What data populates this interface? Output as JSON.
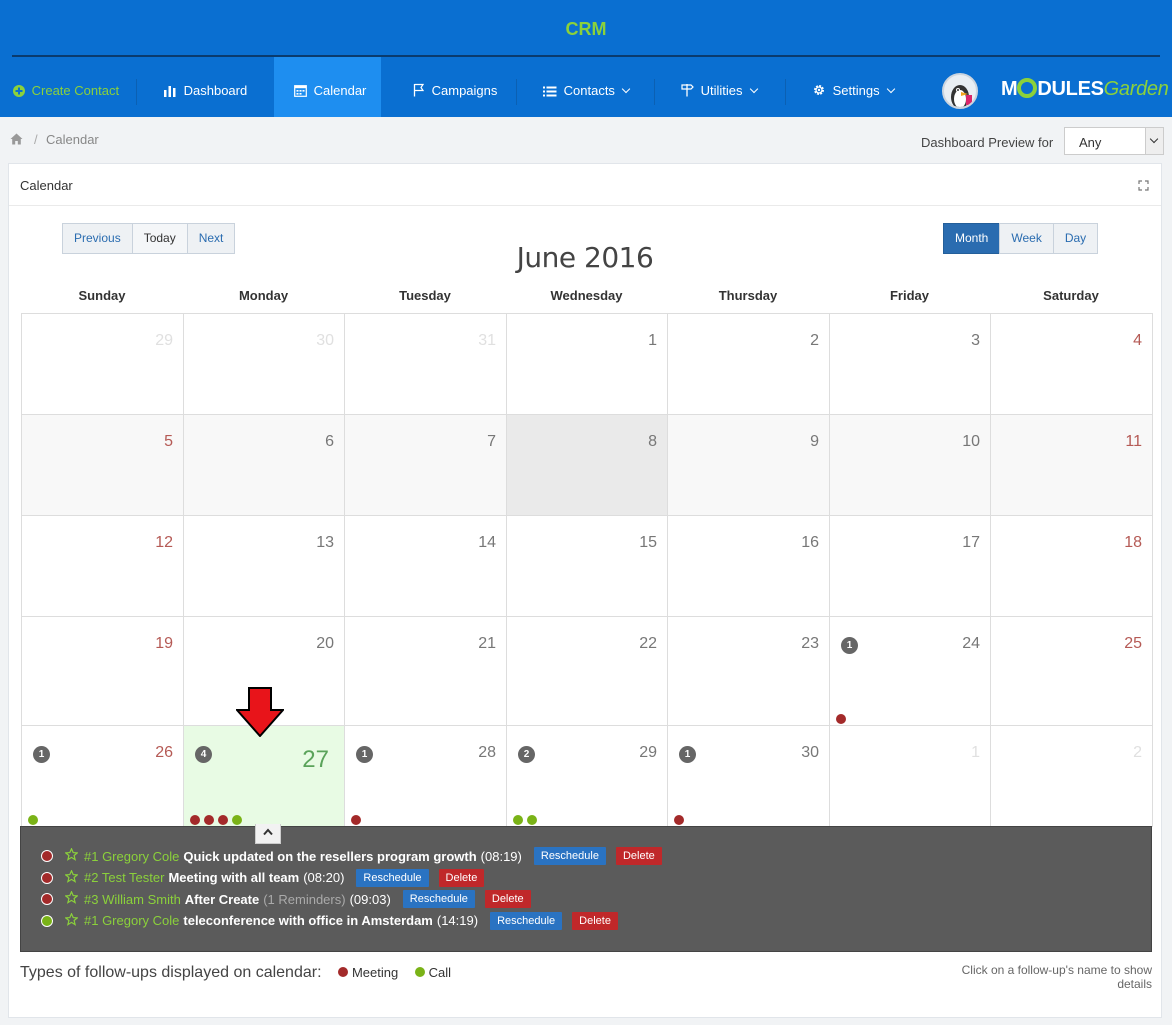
{
  "app": {
    "title": "CRM"
  },
  "nav": {
    "create_contact": "Create Contact",
    "dashboard": "Dashboard",
    "calendar": "Calendar",
    "campaigns": "Campaigns",
    "contacts": "Contacts",
    "utilities": "Utilities",
    "settings": "Settings"
  },
  "logo": {
    "part1": "M",
    "part2": "DULES",
    "part3": "Garden"
  },
  "breadcrumb": {
    "current": "Calendar"
  },
  "preview": {
    "label": "Dashboard Preview for",
    "value": "Any"
  },
  "panel": {
    "title": "Calendar"
  },
  "nav_buttons": {
    "previous": "Previous",
    "today": "Today",
    "next": "Next"
  },
  "view_buttons": {
    "month": "Month",
    "week": "Week",
    "day": "Day",
    "active": "month"
  },
  "calendar": {
    "month_label": "June 2016",
    "weekdays": [
      "Sunday",
      "Monday",
      "Tuesday",
      "Wednesday",
      "Thursday",
      "Friday",
      "Saturday"
    ],
    "weeks": [
      [
        {
          "d": "29",
          "other": true
        },
        {
          "d": "30",
          "other": true
        },
        {
          "d": "31",
          "other": true
        },
        {
          "d": "1"
        },
        {
          "d": "2"
        },
        {
          "d": "3"
        },
        {
          "d": "4"
        }
      ],
      [
        {
          "d": "5"
        },
        {
          "d": "6"
        },
        {
          "d": "7"
        },
        {
          "d": "8",
          "today": true
        },
        {
          "d": "9"
        },
        {
          "d": "10"
        },
        {
          "d": "11"
        }
      ],
      [
        {
          "d": "12"
        },
        {
          "d": "13"
        },
        {
          "d": "14"
        },
        {
          "d": "15"
        },
        {
          "d": "16"
        },
        {
          "d": "17"
        },
        {
          "d": "18"
        }
      ],
      [
        {
          "d": "19"
        },
        {
          "d": "20"
        },
        {
          "d": "21"
        },
        {
          "d": "22"
        },
        {
          "d": "23"
        },
        {
          "d": "24",
          "count": "1",
          "dots": [
            "meeting"
          ]
        },
        {
          "d": "25"
        }
      ],
      [
        {
          "d": "26",
          "count": "1",
          "dots": [
            "call"
          ]
        },
        {
          "d": "27",
          "count": "4",
          "selected": true,
          "dots": [
            "meeting",
            "meeting",
            "meeting",
            "call"
          ]
        },
        {
          "d": "28",
          "count": "1",
          "dots": [
            "meeting"
          ]
        },
        {
          "d": "29",
          "count": "2",
          "dots": [
            "call",
            "call"
          ]
        },
        {
          "d": "30",
          "count": "1",
          "dots": [
            "meeting"
          ]
        },
        {
          "d": "1",
          "other": true
        },
        {
          "d": "2",
          "other": true
        }
      ]
    ]
  },
  "events": [
    {
      "type": "meeting",
      "who": "#1 Gregory Cole",
      "title": "Quick updated on the resellers program growth",
      "reminders": "",
      "time": "(08:19)",
      "reschedule": "Reschedule",
      "delete": "Delete"
    },
    {
      "type": "meeting",
      "who": "#2 Test Tester",
      "title": "Meeting with all team",
      "reminders": "",
      "time": "(08:20)",
      "reschedule": "Reschedule",
      "delete": "Delete"
    },
    {
      "type": "meeting",
      "who": "#3 William Smith",
      "title": "After Create",
      "reminders": "(1 Reminders)",
      "time": "(09:03)",
      "reschedule": "Reschedule",
      "delete": "Delete"
    },
    {
      "type": "call",
      "who": "#1 Gregory Cole",
      "title": "teleconference with office in Amsterdam",
      "reminders": "",
      "time": "(14:19)",
      "reschedule": "Reschedule",
      "delete": "Delete"
    }
  ],
  "legend": {
    "label": "Types of follow-ups displayed on calendar:",
    "meeting": "Meeting",
    "call": "Call",
    "hint": "Click on a follow-up's name to show details"
  },
  "colors": {
    "brand_blue": "#0a6fd1",
    "accent_green": "#8bd13b",
    "meeting": "#a32a2a",
    "call": "#7ab317"
  }
}
